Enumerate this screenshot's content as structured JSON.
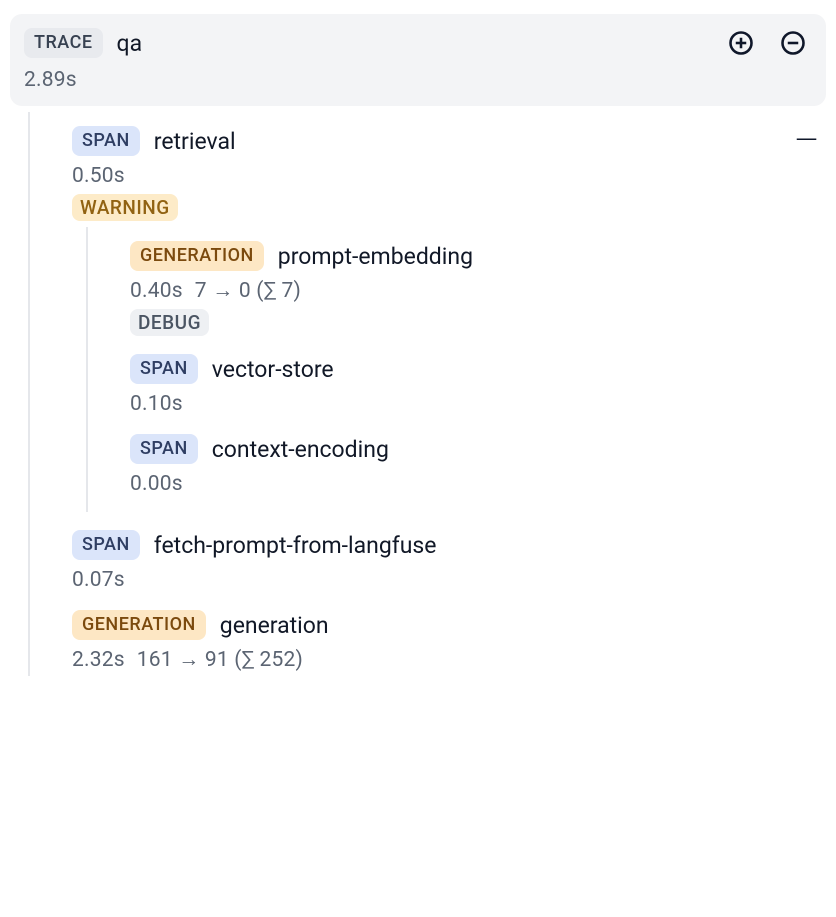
{
  "trace": {
    "badge": "TRACE",
    "title": "qa",
    "duration": "2.89s"
  },
  "nodes": {
    "retrieval": {
      "badge": "SPAN",
      "title": "retrieval",
      "duration": "0.50s",
      "status_label": "WARNING"
    },
    "prompt_embedding": {
      "badge": "GENERATION",
      "title": "prompt-embedding",
      "duration": "0.40s",
      "tokens": "7 → 0 (∑ 7)",
      "status_label": "DEBUG"
    },
    "vector_store": {
      "badge": "SPAN",
      "title": "vector-store",
      "duration": "0.10s"
    },
    "context_encoding": {
      "badge": "SPAN",
      "title": "context-encoding",
      "duration": "0.00s"
    },
    "fetch_prompt": {
      "badge": "SPAN",
      "title": "fetch-prompt-from-langfuse",
      "duration": "0.07s"
    },
    "generation": {
      "badge": "GENERATION",
      "title": "generation",
      "duration": "2.32s",
      "tokens": "161 → 91 (∑ 252)"
    }
  },
  "controls": {
    "collapse_symbol": "—"
  }
}
